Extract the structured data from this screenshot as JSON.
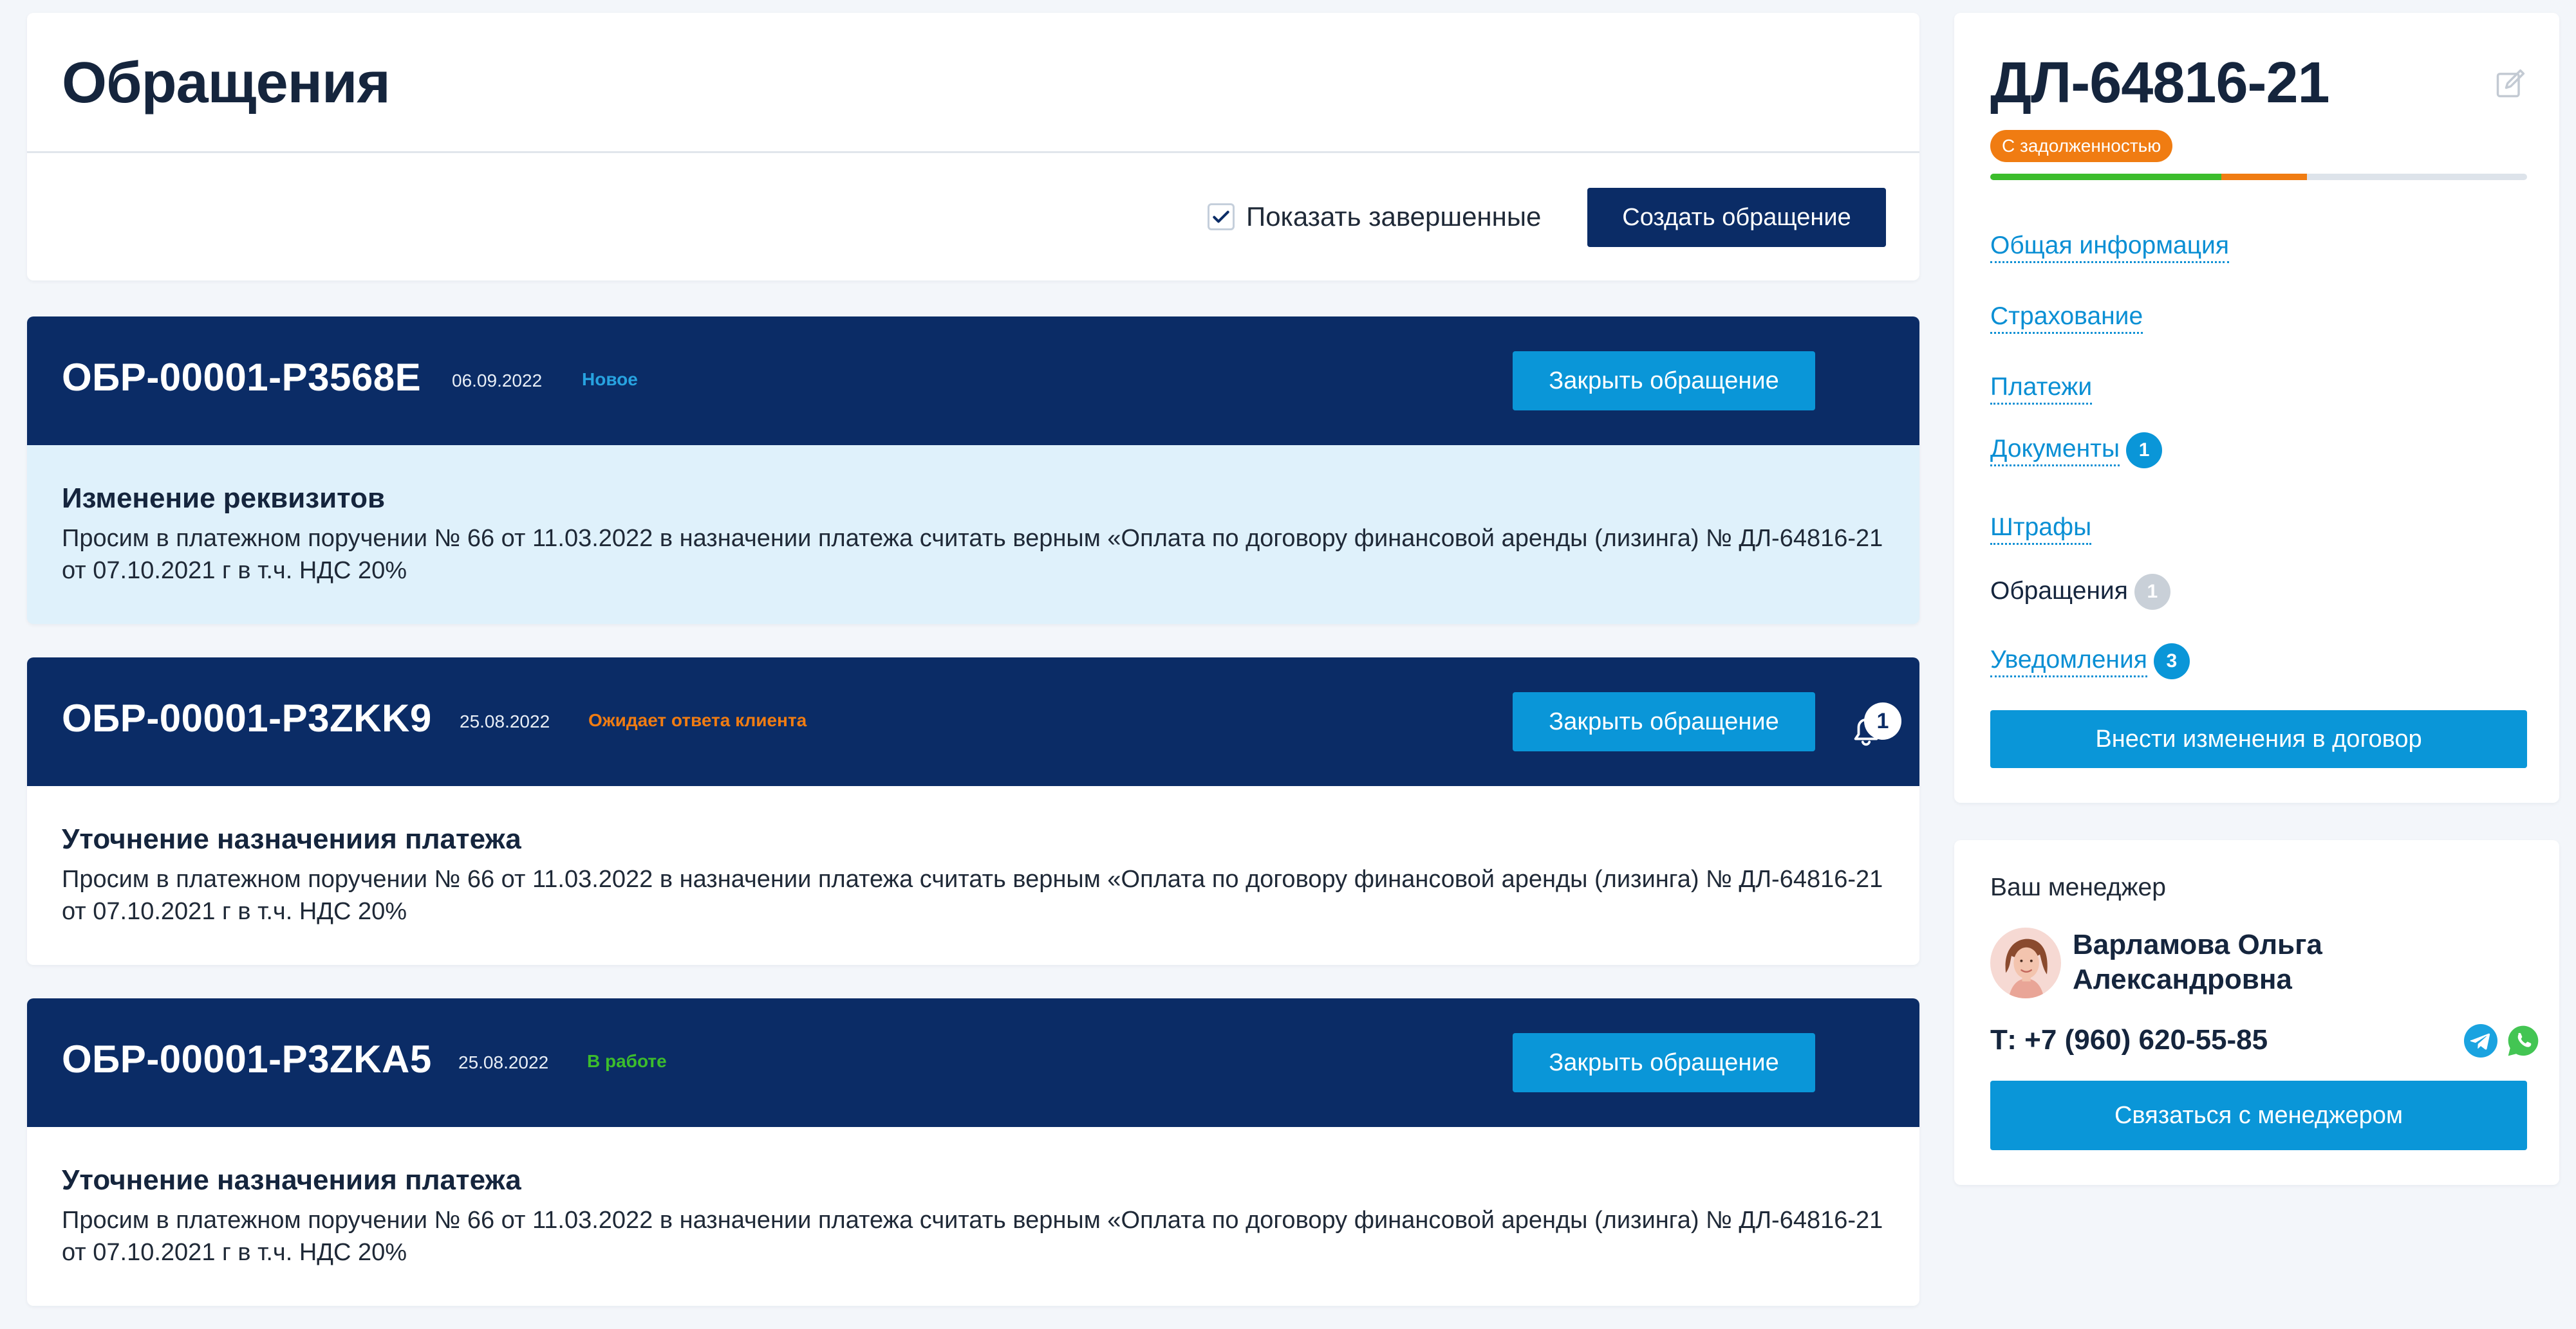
{
  "header": {
    "title": "Обращения",
    "show_completed_label": "Показать завершенные",
    "show_completed_checked": true,
    "create_button_label": "Создать обращение"
  },
  "tickets": [
    {
      "id": "ОБР-00001-Р3568Е",
      "date": "06.09.2022",
      "status": "Новое",
      "status_color": "#27a3e0",
      "close_label": "Закрыть обращение",
      "subject": "Изменение реквизитов",
      "body": "Просим в платежном поручении № 66 от 11.03.2022 в назначении платежа считать верным «Оплата по договору финансовой аренды (лизинга) № ДЛ-64816-21 от 07.10.2021 г в т.ч. НДС 20%",
      "highlighted": true,
      "notifications": null
    },
    {
      "id": "ОБР-00001-Р3ZKK9",
      "date": "25.08.2022",
      "status": "Ожидает ответа клиента",
      "status_color": "#f07c12",
      "close_label": "Закрыть обращение",
      "subject": "Уточнение назначениия платежа",
      "body": "Просим в платежном поручении № 66 от 11.03.2022 в назначении платежа считать верным «Оплата по договору финансовой аренды (лизинга) № ДЛ-64816-21 от 07.10.2021 г в т.ч. НДС 20%",
      "highlighted": false,
      "notifications": "1"
    },
    {
      "id": "ОБР-00001-Р3ZKA5",
      "date": "25.08.2022",
      "status": "В работе",
      "status_color": "#3cbd2c",
      "close_label": "Закрыть обращение",
      "subject": "Уточнение назначениия платежа",
      "body": "Просим в платежном поручении № 66 от 11.03.2022 в назначении платежа считать верным «Оплата по договору финансовой аренды (лизинга) № ДЛ-64816-21 от 07.10.2021 г в т.ч. НДС 20%",
      "highlighted": false,
      "notifications": null
    }
  ],
  "contract": {
    "number": "ДЛ-64816-21",
    "badge": "С задолженностью",
    "progress_paid_fraction": 0.43,
    "progress_overdue_fraction": 0.16,
    "nav": [
      {
        "label": "Общая информация",
        "badge": null,
        "active": false
      },
      {
        "label": "Страхование",
        "badge": null,
        "active": false
      },
      {
        "label": "Платежи",
        "badge": null,
        "active": false
      },
      {
        "label": "Документы",
        "badge": "1",
        "active": false
      },
      {
        "label": "Штрафы",
        "badge": null,
        "active": false
      },
      {
        "label": "Обращения",
        "badge": "1",
        "active": true
      },
      {
        "label": "Уведомления",
        "badge": "3",
        "active": false
      }
    ],
    "amend_button_label": "Внести изменения в договор"
  },
  "manager": {
    "heading": "Ваш менеджер",
    "name": "Варламова Ольга Александровна",
    "phone": "Т: +7 (960) 620-55-85",
    "contact_button_label": "Связаться с менеджером"
  },
  "colors": {
    "navy": "#0b2c66",
    "accent_blue": "#0a96d8",
    "warning_orange": "#f07c12",
    "success_green": "#3cbd2c"
  }
}
